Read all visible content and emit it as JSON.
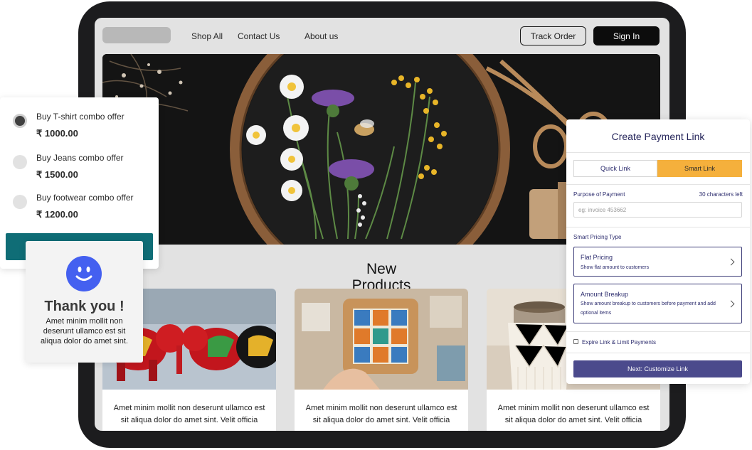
{
  "nav": {
    "links": [
      "Shop All",
      "Contact Us",
      "About us"
    ],
    "track_order": "Track Order",
    "sign_in": "Sign In"
  },
  "section": {
    "title_line1": "New",
    "title_line2": "Products"
  },
  "products": [
    {
      "caption": "Amet minim mollit non deserunt ullamco est sit aliqua dolor do amet sint. Velit officia"
    },
    {
      "caption": "Amet minim mollit non deserunt ullamco est sit aliqua dolor do amet sint. Velit officia"
    },
    {
      "caption": "Amet minim mollit non deserunt ullamco est sit aliqua dolor do amet sint. Velit officia"
    }
  ],
  "offers": [
    {
      "name": "Buy T-shirt combo offer",
      "price": "₹ 1000.00",
      "selected": true
    },
    {
      "name": "Buy Jeans combo offer",
      "price": "₹ 1500.00",
      "selected": false
    },
    {
      "name": "Buy footwear combo offer",
      "price": "₹ 1200.00",
      "selected": false
    }
  ],
  "thank_you": {
    "title": "Thank you !",
    "message": "Amet minim mollit non deserunt ullamco est sit aliqua dolor do amet sint."
  },
  "payment_link": {
    "title": "Create Payment Link",
    "tabs": [
      "Quick Link",
      "Smart Link"
    ],
    "active_tab": "Smart Link",
    "purpose_label": "Purpose of Payment",
    "chars_left": "30 characters left",
    "purpose_placeholder": "eg: invoice 453662",
    "pricing_type_label": "Smart Pricing Type",
    "options": [
      {
        "title": "Flat Pricing",
        "description": "Show flat amount to customers"
      },
      {
        "title": "Amount Breakup",
        "description": "Show amount breakup to customers before payment and add optional items"
      }
    ],
    "expire_label": "Expire Link & Limit Payments",
    "next_button": "Next: Customize Link"
  },
  "colors": {
    "accent_orange": "#f5b03c",
    "primary_indigo": "#4b4a8c",
    "teal": "#0f6d76",
    "smile_blue": "#4460f0"
  }
}
